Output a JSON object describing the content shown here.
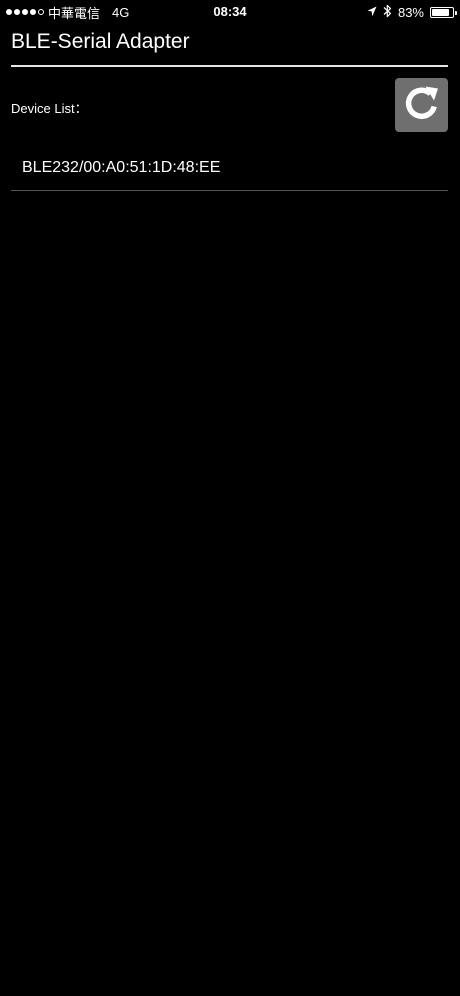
{
  "status_bar": {
    "carrier": "中華電信",
    "network": "4G",
    "time": "08:34",
    "battery_percent": "83%",
    "battery_level": 0.83,
    "signal_bars_filled": 4,
    "signal_bars_total": 5
  },
  "header": {
    "title": "BLE-Serial Adapter"
  },
  "main": {
    "device_list_label": "Device List：",
    "refresh_icon": "refresh-icon",
    "devices": [
      {
        "label": "BLE232/00:A0:51:1D:48:EE"
      }
    ]
  },
  "colors": {
    "background": "#000000",
    "text": "#ffffff",
    "refresh_button_bg": "#6f6f6f",
    "divider": "#e6e6e6",
    "list_divider": "#555555"
  }
}
